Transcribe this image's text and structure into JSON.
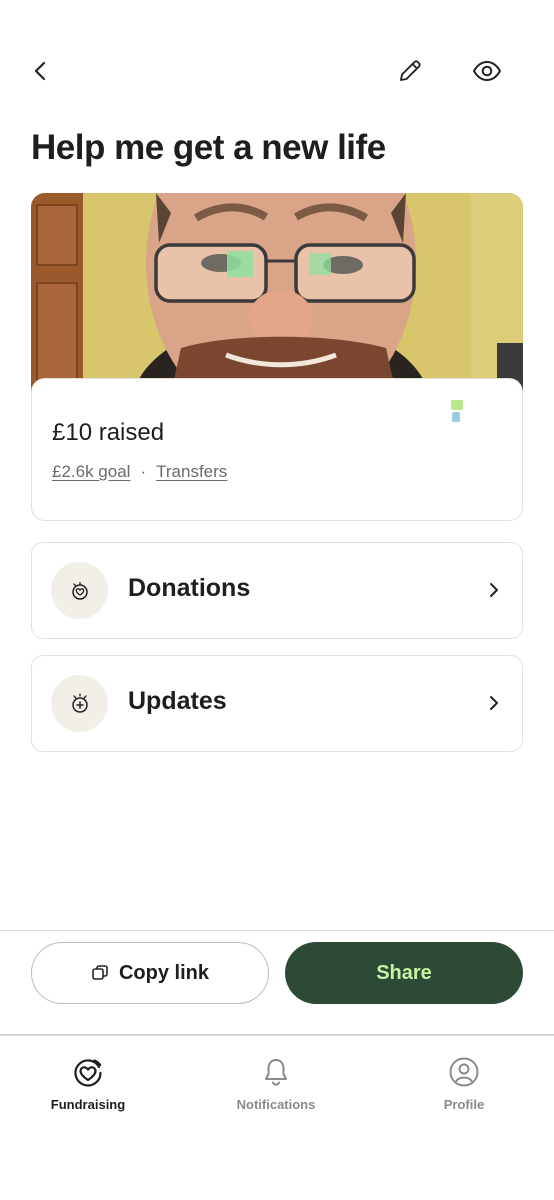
{
  "header": {
    "title": "Help me get a new life"
  },
  "progress": {
    "raised": "£10 raised",
    "goal_link": "£2.6k goal",
    "separator": "·",
    "transfers_link": "Transfers"
  },
  "sections": {
    "donations_label": "Donations",
    "updates_label": "Updates"
  },
  "actions": {
    "copy_link_label": "Copy link",
    "share_label": "Share"
  },
  "bottom_nav": {
    "fundraising_label": "Fundraising",
    "notifications_label": "Notifications",
    "profile_label": "Profile",
    "active": "Fundraising"
  },
  "colors": {
    "primary_button": "#2d4a36",
    "primary_button_text": "#c8f2a0",
    "card_border": "#e4e1d6",
    "icon_circle": "#f2efe8"
  }
}
